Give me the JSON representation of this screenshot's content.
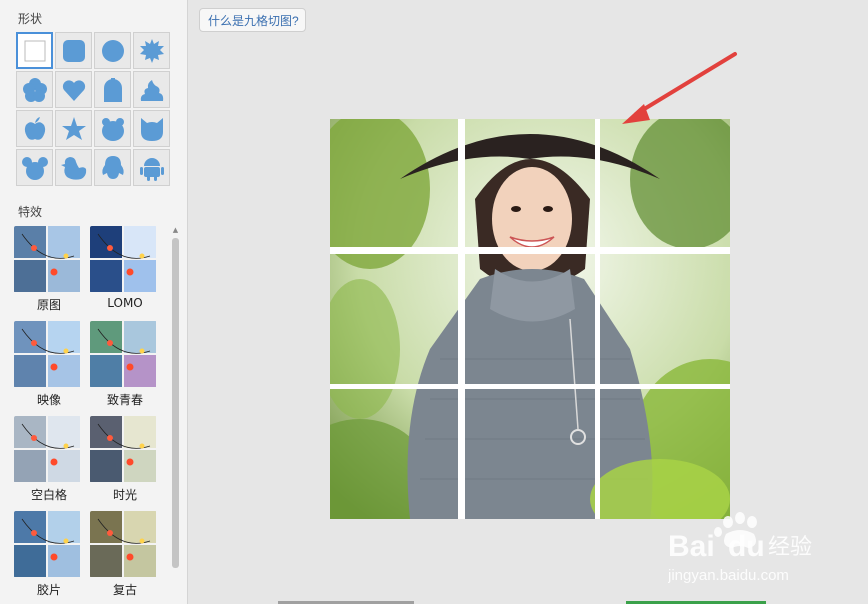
{
  "sidebar": {
    "shapes_title": "形状",
    "effects_title": "特效",
    "shapes": [
      "square-icon",
      "rounded-square-icon",
      "circle-icon",
      "starburst-icon",
      "flower-icon",
      "heart-icon",
      "tombstone-icon",
      "poop-icon",
      "apple-icon",
      "star-icon",
      "bear-icon",
      "cat-icon",
      "mouse-icon",
      "duck-icon",
      "penguin-icon",
      "android-icon"
    ],
    "effects": [
      {
        "label": "原图"
      },
      {
        "label": "LOMO"
      },
      {
        "label": "映像"
      },
      {
        "label": "致青春"
      },
      {
        "label": "空白格"
      },
      {
        "label": "时光"
      },
      {
        "label": "胶片"
      },
      {
        "label": "复古"
      }
    ]
  },
  "toolbar": {
    "help_label": "什么是九格切图?"
  },
  "colors": {
    "accent": "#4a90d9",
    "shape_icon": "#5b9bd5",
    "arrow": "#e2413d"
  },
  "watermark": {
    "brand": "Bai du 经验",
    "url": "jingyan.baidu.com"
  }
}
